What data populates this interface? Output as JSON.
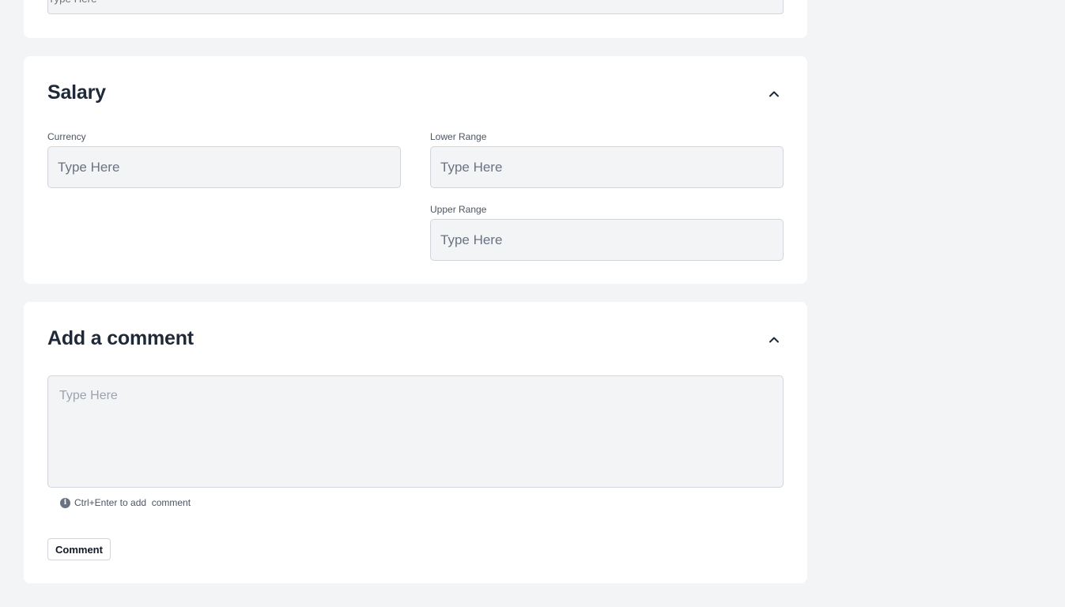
{
  "previous_section": {
    "input_placeholder": "Type Here"
  },
  "salary": {
    "title": "Salary",
    "collapse_icon": "chevron-up-icon",
    "currency": {
      "label": "Currency",
      "placeholder": "Type Here",
      "value": ""
    },
    "lower_range": {
      "label": "Lower Range",
      "placeholder": "Type Here",
      "value": ""
    },
    "upper_range": {
      "label": "Upper Range",
      "placeholder": "Type Here",
      "value": ""
    }
  },
  "comment": {
    "title": "Add a comment",
    "collapse_icon": "chevron-up-icon",
    "placeholder": "Type Here",
    "value": "",
    "hint_icon": "info-icon",
    "hint": "Ctrl+Enter to add  comment",
    "button_label": "Comment"
  },
  "colors": {
    "background": "#f3f4f6",
    "card": "#ffffff",
    "input_bg": "#f3f4f6",
    "input_border": "#d1d5db",
    "text": "#1f2937"
  }
}
